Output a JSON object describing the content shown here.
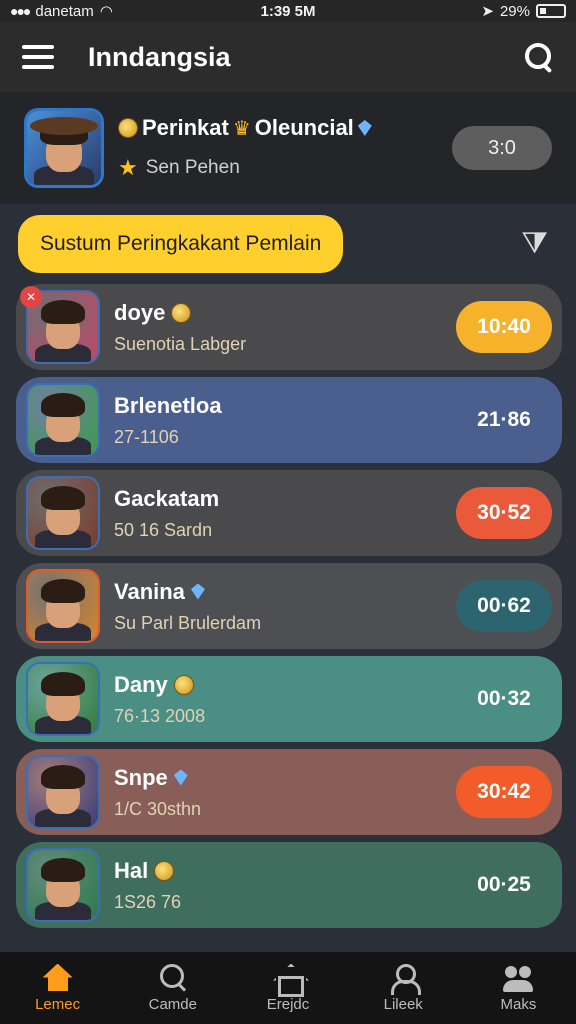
{
  "status_bar": {
    "carrier": "danetam",
    "time": "1:39 5M",
    "battery": "29%"
  },
  "app_bar": {
    "title": "Inndangsia"
  },
  "profile": {
    "name": "Perinkat",
    "name_suffix": "Oleuncial",
    "subtitle": "Sen Pehen",
    "score": "3:0"
  },
  "sort": {
    "label": "Sustum Peringkakant Pemlain"
  },
  "players": [
    {
      "name": "doye",
      "sub": "Suenotia Labger",
      "time": "10:40",
      "row_color": "#4a4a4c",
      "pill_color": "#f5b22a",
      "avatar_bg": "#c0476a",
      "badge": true,
      "icon": "coin"
    },
    {
      "name": "Brlenetloa",
      "sub": "27-1106",
      "time": "21·86",
      "row_color": "#4a5f8e",
      "pill_color": "transparent",
      "avatar_bg": "#3d9b4a",
      "badge": false,
      "icon": ""
    },
    {
      "name": "Gackatam",
      "sub": "50 16 Sardn",
      "time": "30·52",
      "row_color": "#4a4a4c",
      "pill_color": "#ea5a3a",
      "avatar_bg": "#7a3a2a",
      "badge": false,
      "icon": ""
    },
    {
      "name": "Vanina",
      "sub": "Su Parl Brulerdam",
      "time": "00·62",
      "row_color": "#4d4f52",
      "pill_color": "#2c6470",
      "avatar_bg": "#d9862a",
      "badge": false,
      "icon": "gem"
    },
    {
      "name": "Dany",
      "sub": "76·13 2008",
      "time": "00·32",
      "row_color": "#4b8f84",
      "pill_color": "transparent",
      "avatar_bg": "#2f7a3a",
      "badge": false,
      "icon": "coin"
    },
    {
      "name": "Snpe",
      "sub": "1/C 30sthn",
      "time": "30:42",
      "row_color": "#8a5e58",
      "pill_color": "#f25c2a",
      "avatar_bg": "#3a3a7a",
      "badge": false,
      "icon": "gem"
    },
    {
      "name": "Hal",
      "sub": "1S26 76",
      "time": "00·25",
      "row_color": "#3f6e5e",
      "pill_color": "transparent",
      "avatar_bg": "#2a7a4a",
      "badge": false,
      "icon": "coin"
    }
  ],
  "bottom_nav": [
    {
      "label": "Lemec",
      "icon": "home-icon",
      "active": true
    },
    {
      "label": "Camde",
      "icon": "search-icon",
      "active": false
    },
    {
      "label": "Erejdc",
      "icon": "house-icon",
      "active": false
    },
    {
      "label": "Lileek",
      "icon": "user-icon",
      "active": false
    },
    {
      "label": "Maks",
      "icon": "group-icon",
      "active": false
    }
  ],
  "colors": {
    "accent": "#ffcf2e",
    "active_nav": "#ff9d1a"
  }
}
